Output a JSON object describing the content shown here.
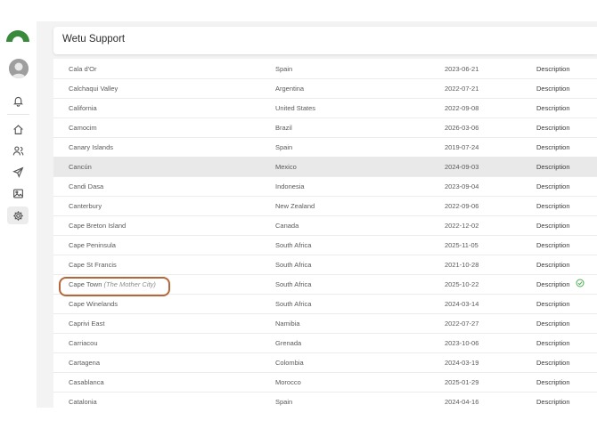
{
  "header": {
    "title": "Wetu Support"
  },
  "colors": {
    "logo_green": "#3a8a3e",
    "annotation": "#b5673a",
    "check_green": "#4caf50"
  },
  "sidebar": {
    "icons": [
      "home-icon",
      "users-icon",
      "send-icon",
      "image-icon",
      "gear-icon"
    ]
  },
  "table": {
    "rows": [
      {
        "name": "Cala d'Or",
        "country": "Spain",
        "date": "2023-06-21",
        "action": "Description"
      },
      {
        "name": "Calchaqui Valley",
        "country": "Argentina",
        "date": "2022-07-21",
        "action": "Description"
      },
      {
        "name": "California",
        "country": "United States",
        "date": "2022-09-08",
        "action": "Description"
      },
      {
        "name": "Camocim",
        "country": "Brazil",
        "date": "2026-03-06",
        "action": "Description"
      },
      {
        "name": "Canary Islands",
        "country": "Spain",
        "date": "2019-07-24",
        "action": "Description"
      },
      {
        "name": "Cancún",
        "country": "Mexico",
        "date": "2024-09-03",
        "action": "Description"
      },
      {
        "name": "Candi Dasa",
        "country": "Indonesia",
        "date": "2023-09-04",
        "action": "Description"
      },
      {
        "name": "Canterbury",
        "country": "New Zealand",
        "date": "2022-09-06",
        "action": "Description"
      },
      {
        "name": "Cape Breton Island",
        "country": "Canada",
        "date": "2022-12-02",
        "action": "Description"
      },
      {
        "name": "Cape Peninsula",
        "country": "South Africa",
        "date": "2025-11-05",
        "action": "Description"
      },
      {
        "name": "Cape St Francis",
        "country": "South Africa",
        "date": "2021-10-28",
        "action": "Description"
      },
      {
        "name": "Cape Town",
        "alt_name": "(The Mother City)",
        "country": "South Africa",
        "date": "2025-10-22",
        "action": "Description"
      },
      {
        "name": "Cape Winelands",
        "country": "South Africa",
        "date": "2024-03-14",
        "action": "Description"
      },
      {
        "name": "Caprivi East",
        "country": "Namibia",
        "date": "2022-07-27",
        "action": "Description"
      },
      {
        "name": "Carriacou",
        "country": "Grenada",
        "date": "2023-10-06",
        "action": "Description"
      },
      {
        "name": "Cartagena",
        "country": "Colombia",
        "date": "2024-03-19",
        "action": "Description"
      },
      {
        "name": "Casablanca",
        "country": "Morocco",
        "date": "2025-01-29",
        "action": "Description"
      },
      {
        "name": "Catalonia",
        "country": "Spain",
        "date": "2024-04-16",
        "action": "Description"
      }
    ]
  }
}
